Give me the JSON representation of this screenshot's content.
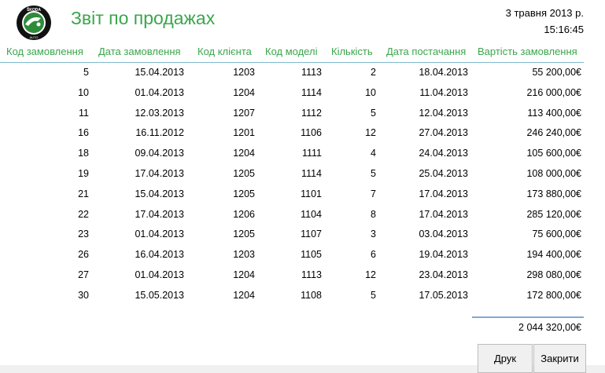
{
  "header": {
    "title": "Звіт по продажах",
    "date": "3 травня 2013 р.",
    "time": "15:16:45",
    "logo_text": "ŠKODA AUTO"
  },
  "columns": [
    "Код замовлення",
    "Дата замовлення",
    "Код клієнта",
    "Код моделі",
    "Кількість",
    "Дата постачання",
    "Вартість замовлення"
  ],
  "rows": [
    [
      "5",
      "15.04.2013",
      "1203",
      "1113",
      "2",
      "18.04.2013",
      "55 200,00€"
    ],
    [
      "10",
      "01.04.2013",
      "1204",
      "1114",
      "10",
      "11.04.2013",
      "216 000,00€"
    ],
    [
      "11",
      "12.03.2013",
      "1207",
      "1112",
      "5",
      "12.04.2013",
      "113 400,00€"
    ],
    [
      "16",
      "16.11.2012",
      "1201",
      "1106",
      "12",
      "27.04.2013",
      "246 240,00€"
    ],
    [
      "18",
      "09.04.2013",
      "1204",
      "1111",
      "4",
      "24.04.2013",
      "105 600,00€"
    ],
    [
      "19",
      "17.04.2013",
      "1205",
      "1114",
      "5",
      "25.04.2013",
      "108 000,00€"
    ],
    [
      "21",
      "15.04.2013",
      "1205",
      "1101",
      "7",
      "17.04.2013",
      "173 880,00€"
    ],
    [
      "22",
      "17.04.2013",
      "1206",
      "1104",
      "8",
      "17.04.2013",
      "285 120,00€"
    ],
    [
      "23",
      "01.04.2013",
      "1205",
      "1107",
      "3",
      "03.04.2013",
      "75 600,00€"
    ],
    [
      "26",
      "16.04.2013",
      "1203",
      "1105",
      "6",
      "19.04.2013",
      "194 400,00€"
    ],
    [
      "27",
      "01.04.2013",
      "1204",
      "1113",
      "12",
      "23.04.2013",
      "298 080,00€"
    ],
    [
      "30",
      "15.05.2013",
      "1204",
      "1108",
      "5",
      "17.05.2013",
      "172 800,00€"
    ]
  ],
  "total": "2 044 320,00€",
  "buttons": {
    "print": "Друк",
    "close": "Закрити"
  },
  "colors": {
    "accent_green": "#3aa64c",
    "rule_blue": "#7fb8cc",
    "logo_green": "#2e8b3a"
  }
}
